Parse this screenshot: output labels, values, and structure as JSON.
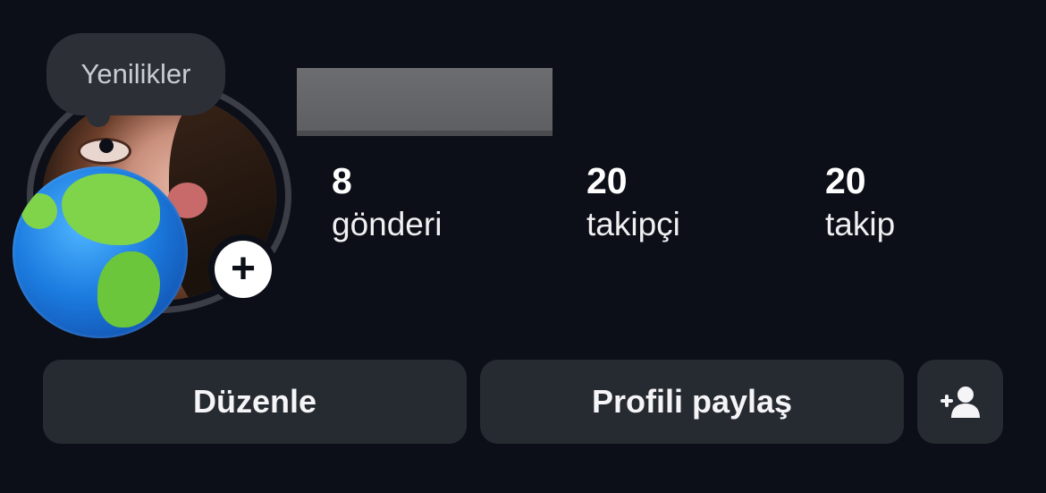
{
  "tooltip": {
    "label": "Yenilikler"
  },
  "profile": {
    "name_redacted": true,
    "stats": [
      {
        "value": "8",
        "label": "gönderi"
      },
      {
        "value": "20",
        "label": "takipçi"
      },
      {
        "value": "20",
        "label": "takip"
      }
    ]
  },
  "buttons": {
    "edit": "Düzenle",
    "share": "Profili paylaş",
    "add_person_icon": "person-add-icon"
  },
  "icons": {
    "add_story": "plus-icon",
    "avatar_badge": "globe-icon"
  },
  "colors": {
    "background": "#0c0f17",
    "button": "#262a31",
    "tooltip": "#2c2f36"
  }
}
